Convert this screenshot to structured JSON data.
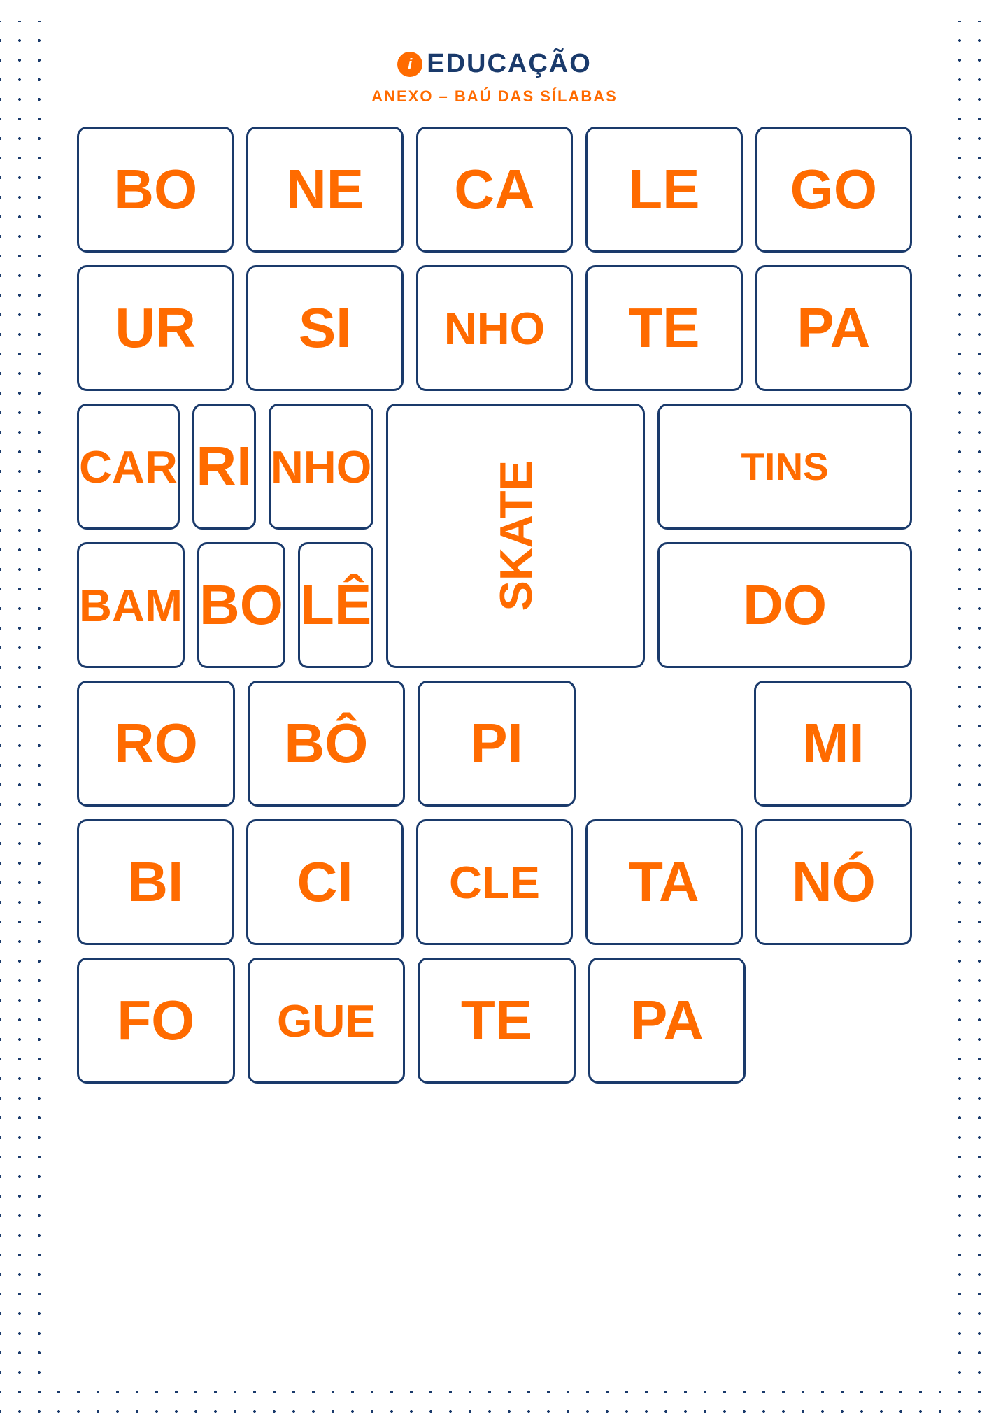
{
  "header": {
    "logo_text": "EDUCAÇÃO",
    "subtitle": "ANEXO – BAÚ DAS SÍLABAS"
  },
  "rows": [
    {
      "id": "row1",
      "cells": [
        {
          "text": "BO",
          "size": "normal"
        },
        {
          "text": "NE",
          "size": "normal"
        },
        {
          "text": "CA",
          "size": "normal"
        },
        {
          "text": "LE",
          "size": "normal"
        },
        {
          "text": "GO",
          "size": "normal"
        }
      ]
    },
    {
      "id": "row2",
      "cells": [
        {
          "text": "UR",
          "size": "normal"
        },
        {
          "text": "SI",
          "size": "normal"
        },
        {
          "text": "NHO",
          "size": "medium"
        },
        {
          "text": "TE",
          "size": "normal"
        },
        {
          "text": "PA",
          "size": "normal"
        }
      ]
    },
    {
      "id": "row3",
      "cells": [
        {
          "text": "CAR",
          "size": "medium"
        },
        {
          "text": "RI",
          "size": "normal"
        },
        {
          "text": "NHO",
          "size": "medium"
        },
        {
          "text": "SKATE",
          "size": "rotated",
          "rowspan": 2
        },
        {
          "text": "TINS",
          "size": "medium"
        }
      ]
    },
    {
      "id": "row4",
      "cells": [
        {
          "text": "BAM",
          "size": "medium"
        },
        {
          "text": "BO",
          "size": "normal"
        },
        {
          "text": "LÊ",
          "size": "normal"
        },
        {
          "text": "DO",
          "size": "normal"
        }
      ]
    },
    {
      "id": "row5",
      "cells": [
        {
          "text": "RO",
          "size": "normal"
        },
        {
          "text": "BÔ",
          "size": "normal"
        },
        {
          "text": "PI",
          "size": "normal"
        },
        {
          "text": "MI",
          "size": "normal"
        }
      ]
    },
    {
      "id": "row6",
      "cells": [
        {
          "text": "BI",
          "size": "normal"
        },
        {
          "text": "CI",
          "size": "normal"
        },
        {
          "text": "CLE",
          "size": "medium"
        },
        {
          "text": "TA",
          "size": "normal"
        },
        {
          "text": "NÓ",
          "size": "normal"
        }
      ]
    },
    {
      "id": "row7",
      "cells": [
        {
          "text": "FO",
          "size": "normal"
        },
        {
          "text": "GUE",
          "size": "medium"
        },
        {
          "text": "TE",
          "size": "normal"
        },
        {
          "text": "PA",
          "size": "normal"
        }
      ]
    }
  ]
}
